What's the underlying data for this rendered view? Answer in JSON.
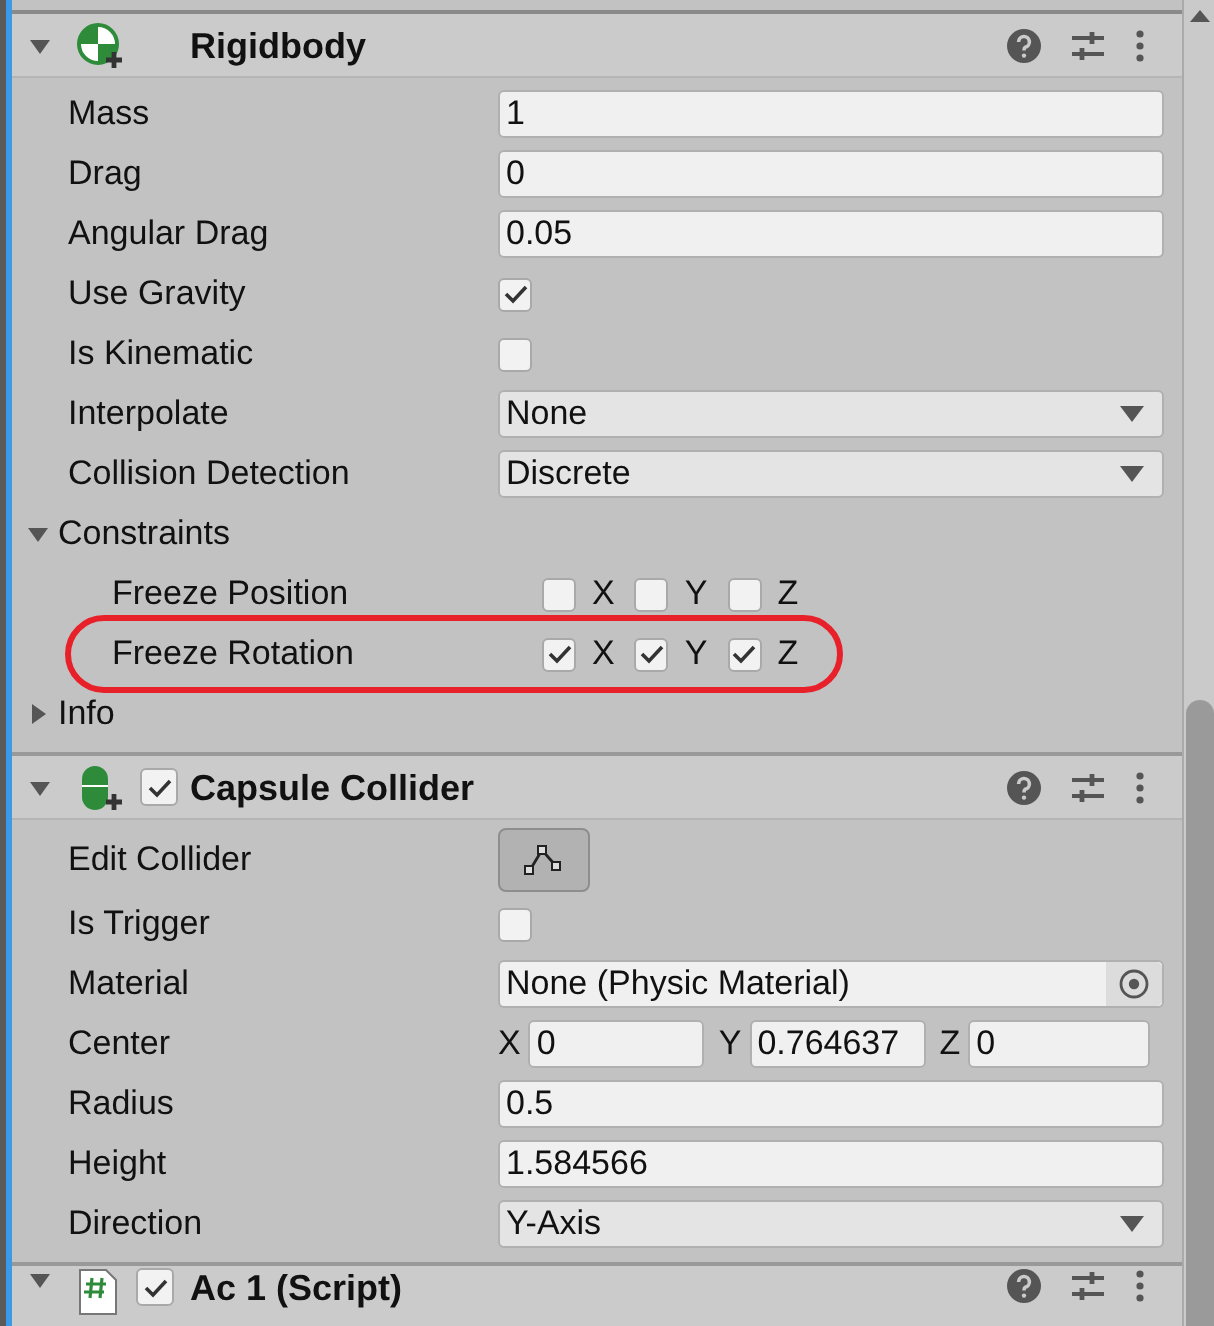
{
  "components": [
    {
      "title": "Rigidbody",
      "kind": "rigidbody",
      "expanded": true,
      "rows": [
        {
          "kind": "field",
          "label": "Mass",
          "value": "1"
        },
        {
          "kind": "field",
          "label": "Drag",
          "value": "0"
        },
        {
          "kind": "field",
          "label": "Angular Drag",
          "value": "0.05"
        },
        {
          "kind": "checkbox",
          "label": "Use Gravity",
          "checked": true
        },
        {
          "kind": "checkbox",
          "label": "Is Kinematic",
          "checked": false
        },
        {
          "kind": "dropdown",
          "label": "Interpolate",
          "value": "None"
        },
        {
          "kind": "dropdown",
          "label": "Collision Detection",
          "value": "Discrete"
        },
        {
          "kind": "foldout",
          "label": "Constraints",
          "expanded": true,
          "children": [
            {
              "kind": "axes",
              "label": "Freeze Position",
              "highlighted": false,
              "axes": [
                {
                  "label": "X",
                  "checked": false
                },
                {
                  "label": "Y",
                  "checked": false
                },
                {
                  "label": "Z",
                  "checked": false
                }
              ]
            },
            {
              "kind": "axes",
              "label": "Freeze Rotation",
              "highlighted": true,
              "axes": [
                {
                  "label": "X",
                  "checked": true
                },
                {
                  "label": "Y",
                  "checked": true
                },
                {
                  "label": "Z",
                  "checked": true
                }
              ]
            }
          ]
        },
        {
          "kind": "foldout",
          "label": "Info",
          "expanded": false
        }
      ]
    },
    {
      "title": "Capsule Collider",
      "kind": "capsule",
      "enabled": true,
      "expanded": true,
      "rows": [
        {
          "kind": "edit",
          "label": "Edit Collider"
        },
        {
          "kind": "checkbox",
          "label": "Is Trigger",
          "checked": false
        },
        {
          "kind": "object",
          "label": "Material",
          "value": "None (Physic Material)"
        },
        {
          "kind": "vector",
          "label": "Center",
          "axes": [
            {
              "label": "X",
              "value": "0"
            },
            {
              "label": "Y",
              "value": "0.764637"
            },
            {
              "label": "Z",
              "value": "0"
            }
          ]
        },
        {
          "kind": "field",
          "label": "Radius",
          "value": "0.5"
        },
        {
          "kind": "field",
          "label": "Height",
          "value": "1.584566"
        },
        {
          "kind": "dropdown",
          "label": "Direction",
          "value": "Y-Axis"
        }
      ]
    },
    {
      "title": "Ac 1 (Script)",
      "kind": "script",
      "enabled": true,
      "expanded": true
    }
  ]
}
